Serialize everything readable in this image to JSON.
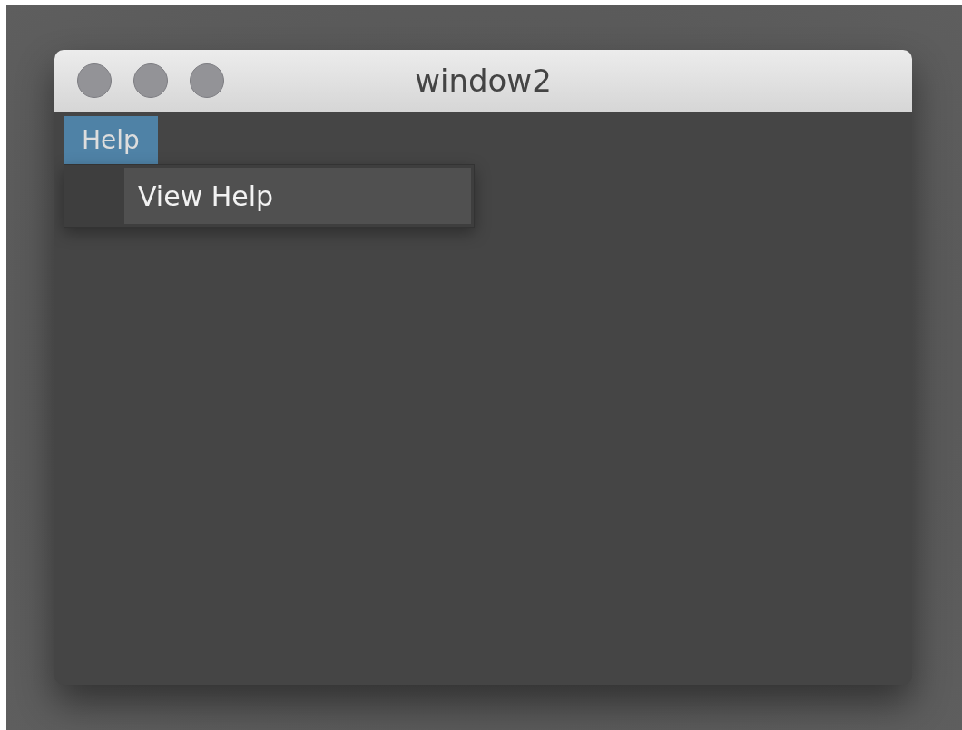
{
  "window": {
    "title": "window2"
  },
  "menu_bar": [
    {
      "label": "Help",
      "selected": true
    }
  ],
  "open_menu": {
    "items": [
      {
        "label": "View Help"
      }
    ]
  }
}
